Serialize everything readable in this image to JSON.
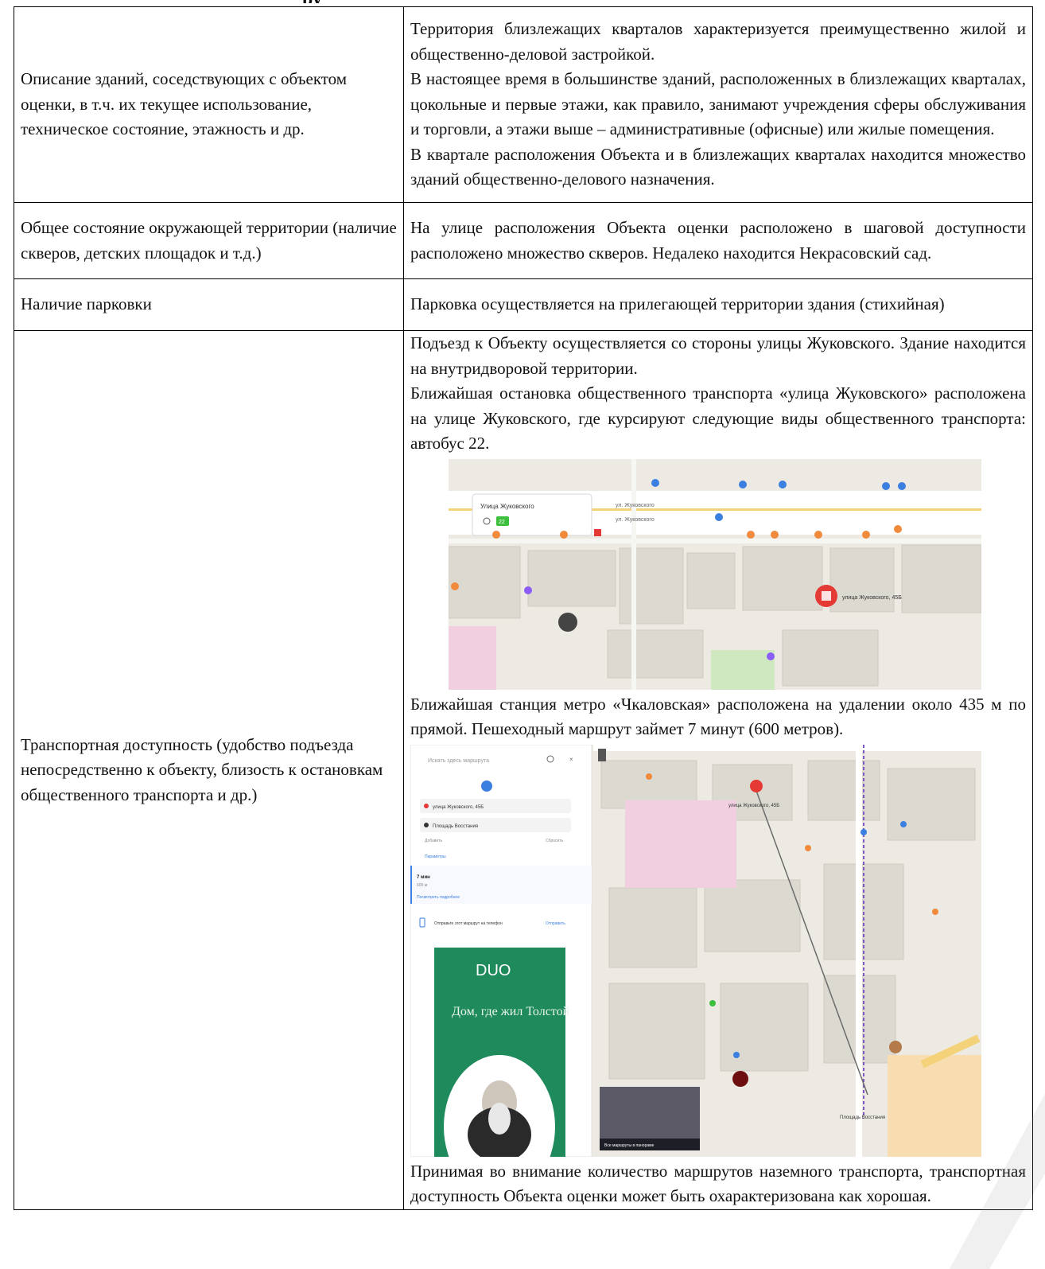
{
  "header": {
    "title_fragment": "ру"
  },
  "rows": [
    {
      "label": "Описание зданий, соседствующих с объектом оценки, в т.ч. их текущее использование, техническое состояние, этажность и др.",
      "paragraphs": [
        "Территория близлежащих кварталов характеризуется преимущественно жилой и общественно-деловой застройкой.",
        "В настоящее время в большинстве зданий, расположенных в близлежащих кварталах, цокольные и первые этажи, как правило, занимают учреждения сферы обслуживания и торговли, а этажи выше – административные (офисные) или жилые помещения.",
        "В квартале расположения Объекта и в близлежащих кварталах находится множество зданий общественно-делового назначения."
      ]
    },
    {
      "label": "Общее состояние окружающей территории (наличие скверов, детских площадок и т.д.)",
      "paragraphs": [
        "На улице расположения Объекта оценки расположено в шаговой доступности расположено множество скверов. Недалеко находится Некрасовский сад."
      ]
    },
    {
      "label": "Наличие парковки",
      "paragraphs": [
        "Парковка осуществляется на прилегающей территории здания (стихийная)"
      ]
    },
    {
      "label": "Транспортная доступность (удобство подъезда непосредственно к объекту, близость к остановкам общественного транспорта и др.)",
      "p1": "Подъезд к Объекту осуществляется со стороны улицы Жуковского. Здание находится на внутридворовой территории.",
      "p2": "Ближайшая остановка общественного транспорта «улица Жуковского» расположена на улице Жуковского, где курсируют следующие виды общественного транспорта: автобус 22.",
      "p3": "Ближайшая станция метро «Чкаловская» расположена на удалении около 435 м по прямой. Пешеходный маршрут займет 7 минут (600 метров).",
      "p4": "Принимая во внимание количество маршрутов наземного транспорта, транспортная доступность Объекта оценки может быть охарактеризована как хорошая."
    }
  ],
  "map1": {
    "stop_card_title": "Улица Жуковского",
    "stop_card_route": "22",
    "street_label_1": "ул. Жуковского",
    "street_label_2": "ул. Жуковского",
    "pin_label": "улица Жуковского, 45Б"
  },
  "map2": {
    "search_placeholder": "Искать здесь маршрута",
    "route_from": "улица Жуковского, 45Б",
    "route_to": "Площадь Восстания",
    "add_link": "Добавить",
    "reset_link": "Сбросить",
    "params_link": "Параметры",
    "route_time": "7 мин",
    "route_distance": "600 м",
    "details_link": "Посмотреть подробнее",
    "send_text": "Отправьте этот маршрут на телефон",
    "send_button": "Отправить",
    "ad_logo": "DUO",
    "ad_text": "Дом, где жил Толстой",
    "pin_label": "улица Жуковского, 45Б",
    "metro_label": "Площадь Восстания",
    "photo_caption": "Все маршруты в панораме"
  },
  "colors": {
    "map_bg": "#eceae3",
    "road": "#ffffff",
    "block": "#dcd9d0",
    "pin_red": "#e53935",
    "poi_blue": "#3b7fe0",
    "poi_orange": "#f08a3c",
    "green_ad": "#1f8a5b",
    "route_line": "#6b6b6b"
  }
}
